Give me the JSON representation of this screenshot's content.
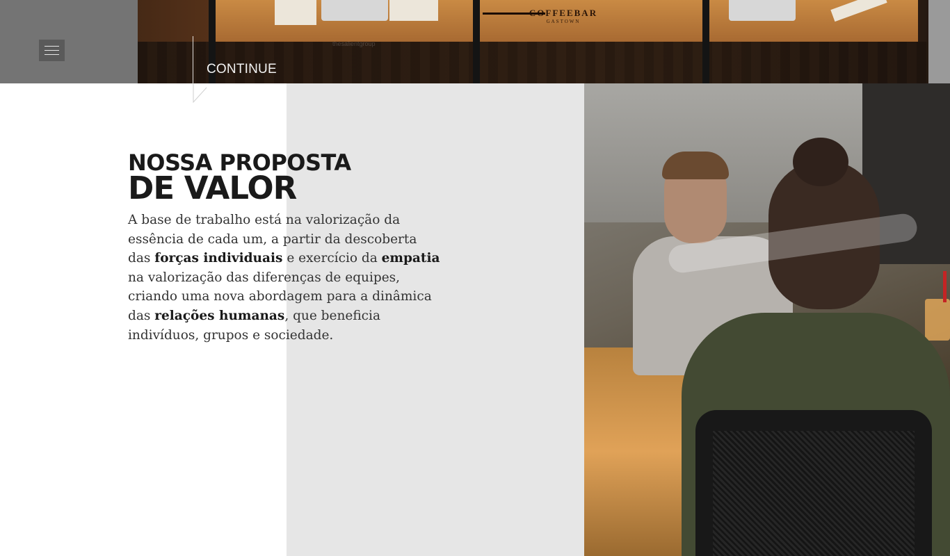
{
  "hero": {
    "sign_title": "COFFEEBAR",
    "sign_subtitle": "GASTOWN",
    "watermark": "thesalientgroup",
    "continue_label": "CONTINUE"
  },
  "menu": {
    "icon": "hamburger-menu-icon"
  },
  "section": {
    "heading_line1": "NOSSA PROPOSTA",
    "heading_line2": "DE VALOR",
    "body": [
      {
        "text": "A base de trabalho está na valorização da essência de cada um, a partir da descoberta das ",
        "bold": false
      },
      {
        "text": "forças individuais",
        "bold": true
      },
      {
        "text": " e exercício da ",
        "bold": false
      },
      {
        "text": "empatia",
        "bold": true
      },
      {
        "text": " na valorização das diferenças de equipes, criando uma nova abordagem para a dinâmica das ",
        "bold": false
      },
      {
        "text": "relações humanas",
        "bold": true
      },
      {
        "text": ", que beneficia indivíduos, grupos e sociedade.",
        "bold": false
      }
    ]
  },
  "colors": {
    "grey_panel": "#e6e6e6",
    "menu_bg": "#5a5a5a",
    "heading": "#1a1a1a",
    "body_text": "#333333"
  }
}
